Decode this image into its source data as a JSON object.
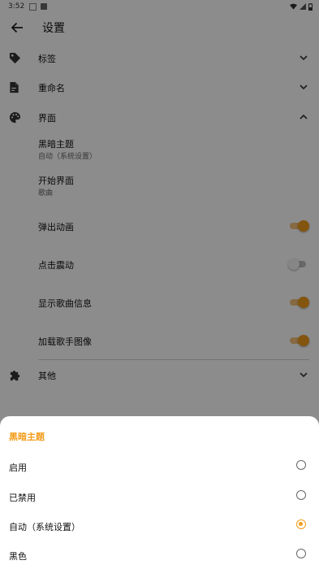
{
  "status_bar": {
    "time": "3:52"
  },
  "app_bar": {
    "title": "设置"
  },
  "settings": {
    "tags": {
      "label": "标签"
    },
    "rename": {
      "label": "重命名"
    },
    "interface": {
      "label": "界面",
      "items": {
        "dark_theme": {
          "title": "黑暗主题",
          "value": "自动（系统设置）"
        },
        "start_screen": {
          "title": "开始界面",
          "value": "歌曲"
        },
        "popup_animation": {
          "title": "弹出动画",
          "enabled": true
        },
        "tap_vibration": {
          "title": "点击震动",
          "enabled": false
        },
        "show_song_info": {
          "title": "显示歌曲信息",
          "enabled": true
        },
        "load_artist_image": {
          "title": "加载歌手图像",
          "enabled": true
        }
      }
    },
    "other": {
      "label": "其他"
    }
  },
  "sheet": {
    "title": "黑暗主题",
    "options": [
      {
        "label": "启用",
        "selected": false
      },
      {
        "label": "已禁用",
        "selected": false
      },
      {
        "label": "自动（系统设置）",
        "selected": true
      },
      {
        "label": "黑色",
        "selected": false
      }
    ]
  },
  "colors": {
    "accent": "#f29d1b"
  }
}
